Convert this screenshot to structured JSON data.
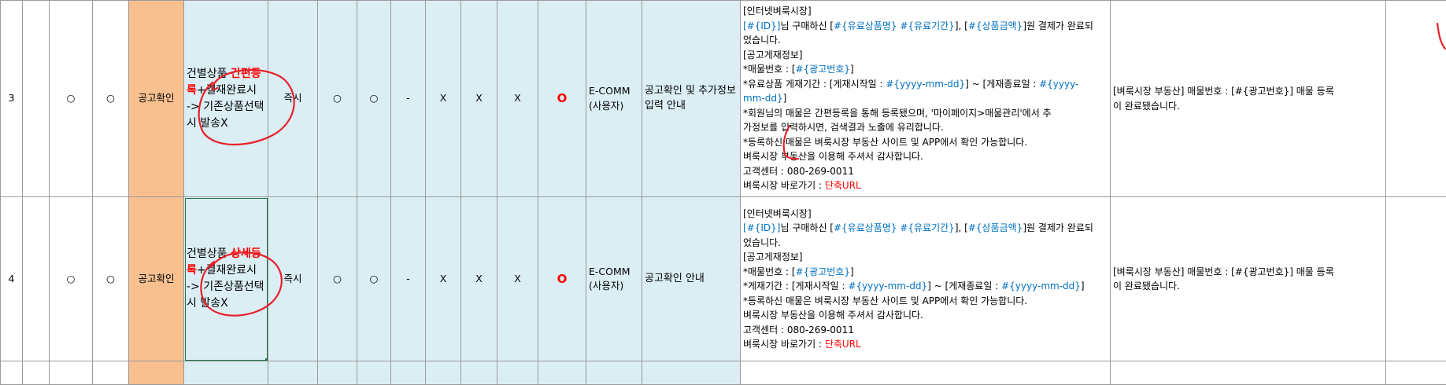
{
  "rows": [
    {
      "no": "3",
      "c1": "○",
      "c2": "○",
      "category": "공고확인",
      "condition_pre": "건별상품 ",
      "condition_highlight": "간편등록",
      "condition_post": "+결재완료시",
      "condition_line2": "-> 기존상품선택 시 발송X",
      "timing": "즉시",
      "m1": "○",
      "m2": "○",
      "m3": "-",
      "x1": "X",
      "x2": "X",
      "x3": "X",
      "o_red": "O",
      "target_line1": "E-COMM",
      "target_line2": "(사용자)",
      "title_line1": "공고확인 및 추가정보",
      "title_line2": "입력 안내",
      "sms_right": "[벼룩시장 부동산] 매물번호 : [#{광고번호}] 매물 등록",
      "sms_right2": "이 완료됐습니다."
    },
    {
      "no": "4",
      "c1": "○",
      "c2": "○",
      "category": "공고확인",
      "condition_pre": "건별상품 ",
      "condition_highlight": "상세등록",
      "condition_post": "+결재완료시",
      "condition_line2": "-> 기존상품선택 시 발송X",
      "timing": "즉시",
      "m1": "○",
      "m2": "○",
      "m3": "-",
      "x1": "X",
      "x2": "X",
      "x3": "X",
      "o_red": "O",
      "target_line1": "E-COMM",
      "target_line2": "(사용자)",
      "title_line1": "공고확인 안내",
      "sms_right": "[벼룩시장 부동산] 매물번호 : [#{광고번호}] 매물 등록",
      "sms_right2": "이 완료됐습니다."
    }
  ],
  "msg3": {
    "l1": "[인터넷벼룩시장]",
    "l2a": "[#{ID}]",
    "l2b": "님 구매하신 [",
    "l2c": "#{유료상품명} #{유료기간}",
    "l2d": "], [",
    "l2e": "#{상품금액}",
    "l2f": "]원 결제가 완료되",
    "l3": "었습니다.",
    "l4": "[공고게재정보]",
    "l5a": "*매물번호 : [",
    "l5b": "#{광고번호}",
    "l5c": "]",
    "l6a": "*유료상품 게재기간 : [게재시작일 : ",
    "l6b": "#{yyyy-mm-dd}",
    "l6c": "] ~ [게재종료일 : ",
    "l6d": "#{yyyy-",
    "l7a": "mm-dd}",
    "l7b": "]",
    "l8": "*회원님의 매물은 간편등록을 통해 등록됐으며, '마이페이지>매물관리'에서 추",
    "l9": "가정보를 입력하시면, 검색결과 노출에 유리합니다.",
    "l10": "*등록하신 매물은 벼룩시장 부동산 사이트 및 APP에서 확인 가능합니다.",
    "l11": "벼룩시장 부동산을 이용해 주셔서 감사합니다.",
    "l12": "고객센터 : 080-269-0011",
    "l13a": "벼룩시장 바로가기 : ",
    "l13b": "단축URL"
  },
  "msg4": {
    "l1": "[인터넷벼룩시장]",
    "l2a": "[#{ID}]",
    "l2b": "님 구매하신 [",
    "l2c": "#{유료상품명} #{유료기간}",
    "l2d": "], [",
    "l2e": "#{상품금액}",
    "l2f": "]원 결제가 완료되",
    "l3": "었습니다.",
    "l4": "[공고게재정보]",
    "l5a": "*매물번호 : [",
    "l5b": "#{광고번호}",
    "l5c": "]",
    "l6a": "*게재기간 : [게재시작일 : ",
    "l6b": "#{yyyy-mm-dd}",
    "l6c": "] ~ [게재종료일 : ",
    "l6d": "#{yyyy-mm-dd}",
    "l6e": "]",
    "l7": "*등록하신 매물은 벼룩시장 부동산 사이트 및 APP에서 확인 가능합니다.",
    "l8": "벼룩시장 부동산을 이용해 주셔서 감사합니다.",
    "l9": "고객센터 : 080-269-0011",
    "l10a": "벼룩시장 바로가기 : ",
    "l10b": "단축URL"
  },
  "colors": {
    "category_bg": "#f8bf8f",
    "condition_bg": "#dbeef4",
    "variable_text": "#0070c0",
    "highlight_text": "#ff0000",
    "ink": "#e8202a",
    "grid": "#9a9a9a",
    "selection": "#217346"
  }
}
